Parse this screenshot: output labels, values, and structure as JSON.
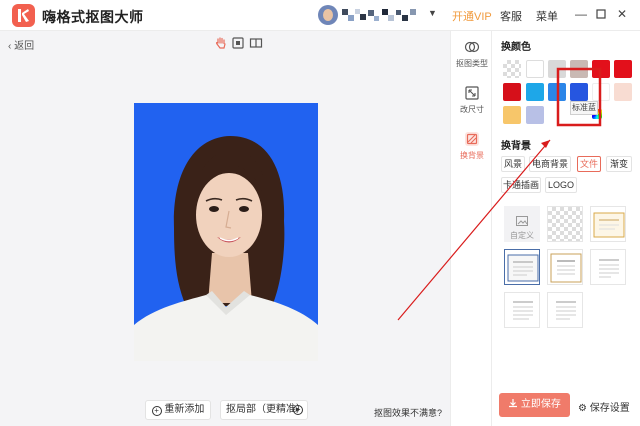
{
  "app": {
    "title": "嗨格式抠图大师"
  },
  "header": {
    "vip_label": "开通VIP",
    "service_label": "客服",
    "menu_label": "菜单"
  },
  "toolbar": {
    "back_label": "返回"
  },
  "canvas": {
    "background_color": "#2162f0",
    "readd_label": "重新添加",
    "refine_label": "抠局部（更精准）",
    "unsatisfied_label": "抠图效果不满意?"
  },
  "midnav": {
    "items": [
      {
        "label": "抠图类型",
        "icon": "cutout-type-icon"
      },
      {
        "label": "改尺寸",
        "icon": "resize-icon"
      },
      {
        "label": "换背景",
        "icon": "background-icon"
      }
    ]
  },
  "color_section": {
    "title": "换颜色",
    "swatches": [
      "transparent",
      "#ffffff",
      "#d9d9d9",
      "#c9b9b3",
      "#e2101b",
      "#e2101b",
      "#e2101b",
      "#1ea7e8",
      "#2c86e8",
      "#2656e0",
      "#ffffff",
      "#f8dcd2",
      "#f7c66a",
      "#b8c0e6",
      "#ffffff",
      "#ffffff",
      "#ffffff",
      "#ffffff"
    ],
    "tooltip": "标准蓝"
  },
  "bg_section": {
    "title": "换背景",
    "tabs": [
      "风景",
      "电商背景",
      "文件",
      "渐变",
      "卡通插画",
      "LOGO"
    ],
    "active_tab": "文件",
    "custom_label": "自定义"
  },
  "footer": {
    "save_now_label": "立即保存",
    "save_settings_label": "保存设置"
  },
  "colors": {
    "accent": "#f07b6a",
    "vip": "#f19b3e",
    "annotation": "#d91c1c"
  }
}
